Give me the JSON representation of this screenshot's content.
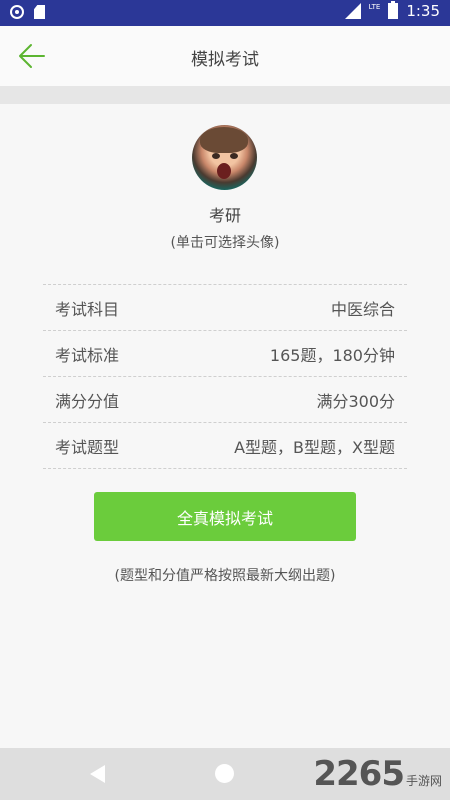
{
  "status_bar": {
    "network": "LTE",
    "time": "1:35"
  },
  "header": {
    "title": "模拟考试"
  },
  "profile": {
    "name": "考研",
    "hint": "(单击可选择头像)"
  },
  "info_rows": [
    {
      "label": "考试科目",
      "value": "中医综合"
    },
    {
      "label": "考试标准",
      "value": "165题，180分钟"
    },
    {
      "label": "满分分值",
      "value": "满分300分"
    },
    {
      "label": "考试题型",
      "value": "A型题，B型题，X型题"
    }
  ],
  "action": {
    "button_label": "全真模拟考试"
  },
  "footnote": "(题型和分值严格按照最新大纲出题)",
  "watermark": {
    "number": "2265",
    "text": "手游网"
  },
  "colors": {
    "status_bar": "#2b3797",
    "accent_green": "#6bcc3c",
    "back_arrow": "#5cb531"
  }
}
